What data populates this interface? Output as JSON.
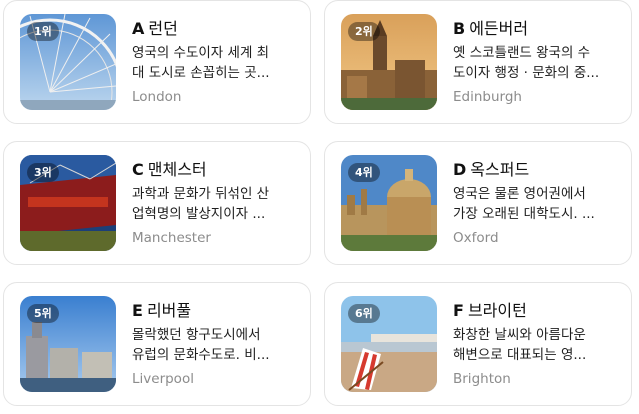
{
  "cities": [
    {
      "rank": "1위",
      "letter": "A",
      "name": "런던",
      "desc_line1": "영국의 수도이자 세계 최",
      "desc_line2": "대 도시로 손꼽히는 곳...",
      "english": "London",
      "image": "london-eye-photo"
    },
    {
      "rank": "2위",
      "letter": "B",
      "name": "에든버러",
      "desc_line1": "옛 스코틀랜드 왕국의 수",
      "desc_line2": "도이자 행정 · 문화의 중...",
      "english": "Edinburgh",
      "image": "edinburgh-castle-photo"
    },
    {
      "rank": "3위",
      "letter": "C",
      "name": "맨체스터",
      "desc_line1": "과학과 문화가 뒤섞인 산",
      "desc_line2": "업혁명의 발상지이자 ...",
      "english": "Manchester",
      "image": "old-trafford-stadium-photo"
    },
    {
      "rank": "4위",
      "letter": "D",
      "name": "옥스퍼드",
      "desc_line1": "영국은 물론 영어권에서",
      "desc_line2": "가장 오래된 대학도시. ...",
      "english": "Oxford",
      "image": "radcliffe-camera-photo"
    },
    {
      "rank": "5위",
      "letter": "E",
      "name": "리버풀",
      "desc_line1": "몰락했던 항구도시에서",
      "desc_line2": "유럽의 문화수도로. 비...",
      "english": "Liverpool",
      "image": "liverpool-waterfront-photo"
    },
    {
      "rank": "6위",
      "letter": "F",
      "name": "브라이턴",
      "desc_line1": "화창한 날씨와 아름다운",
      "desc_line2": "해변으로 대표되는 영...",
      "english": "Brighton",
      "image": "brighton-beach-pier-photo"
    }
  ]
}
